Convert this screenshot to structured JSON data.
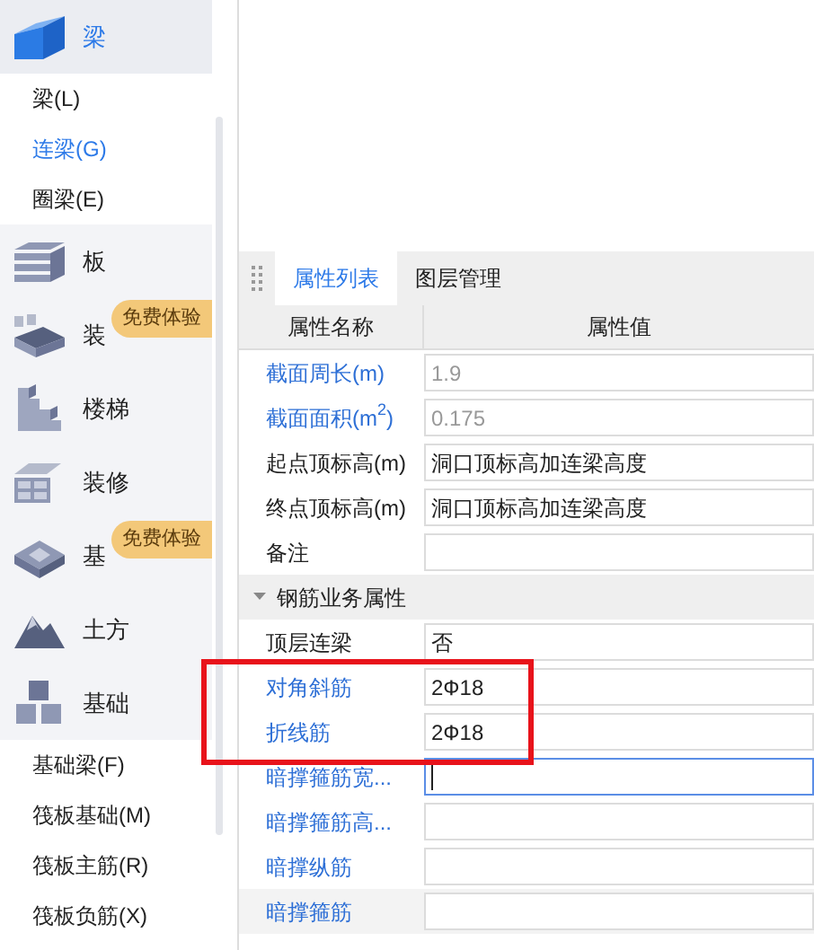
{
  "sidebar": {
    "categories": [
      {
        "label": "梁",
        "selected": true,
        "children": [
          {
            "label": "梁(L)",
            "selected": false
          },
          {
            "label": "连梁(G)",
            "selected": true
          },
          {
            "label": "圈梁(E)",
            "selected": false
          }
        ]
      },
      {
        "label": "板",
        "selected": false
      },
      {
        "label": "装",
        "selected": false,
        "badge": "免费体验"
      },
      {
        "label": "楼梯",
        "selected": false
      },
      {
        "label": "装修",
        "selected": false
      },
      {
        "label": "基",
        "selected": false,
        "badge": "免费体验"
      },
      {
        "label": "土方",
        "selected": false
      },
      {
        "label": "基础",
        "selected": false,
        "children": [
          {
            "label": "基础梁(F)",
            "selected": false
          },
          {
            "label": "筏板基础(M)",
            "selected": false
          },
          {
            "label": "筏板主筋(R)",
            "selected": false
          },
          {
            "label": "筏板负筋(X)",
            "selected": false
          }
        ]
      }
    ]
  },
  "tabs": [
    {
      "label": "属性列表",
      "selected": true
    },
    {
      "label": "图层管理",
      "selected": false
    }
  ],
  "table": {
    "columns": [
      "属性名称",
      "属性值"
    ],
    "rows": [
      {
        "kind": "property",
        "name": "截面周长(m)",
        "name_linked": true,
        "value": "1.9",
        "readonly": true
      },
      {
        "kind": "property",
        "name": "截面面积(m$^{2}$)",
        "name_linked": true,
        "value": "0.175",
        "readonly": true
      },
      {
        "kind": "property",
        "name": "起点顶标高(m)",
        "name_linked": false,
        "value": "洞口顶标高加连梁高度",
        "readonly": false
      },
      {
        "kind": "property",
        "name": "终点顶标高(m)",
        "name_linked": false,
        "value": "洞口顶标高加连梁高度",
        "readonly": false
      },
      {
        "kind": "property",
        "name": "备注",
        "name_linked": false
      },
      {
        "kind": "section",
        "name": "钢筋业务属性",
        "expanded": true
      },
      {
        "kind": "property",
        "name": "顶层连梁",
        "name_linked": false,
        "value": "否",
        "readonly": false
      },
      {
        "kind": "property",
        "name": "对角斜筋",
        "name_linked": true,
        "value": "2Ф18",
        "readonly": false,
        "highlighted": true
      },
      {
        "kind": "property",
        "name": "折线筋",
        "name_linked": true,
        "value": "2Ф18",
        "readonly": false,
        "highlighted": true
      },
      {
        "kind": "property",
        "name": "暗撑箍筋宽...",
        "name_linked": true,
        "readonly": false,
        "focused": true
      },
      {
        "kind": "property",
        "name": "暗撑箍筋高...",
        "name_linked": true,
        "readonly": false
      },
      {
        "kind": "property",
        "name": "暗撑纵筋",
        "name_linked": true,
        "readonly": false
      },
      {
        "kind": "property",
        "name": "暗撑箍筋",
        "name_linked": true,
        "readonly": false,
        "hovered": true
      }
    ]
  }
}
